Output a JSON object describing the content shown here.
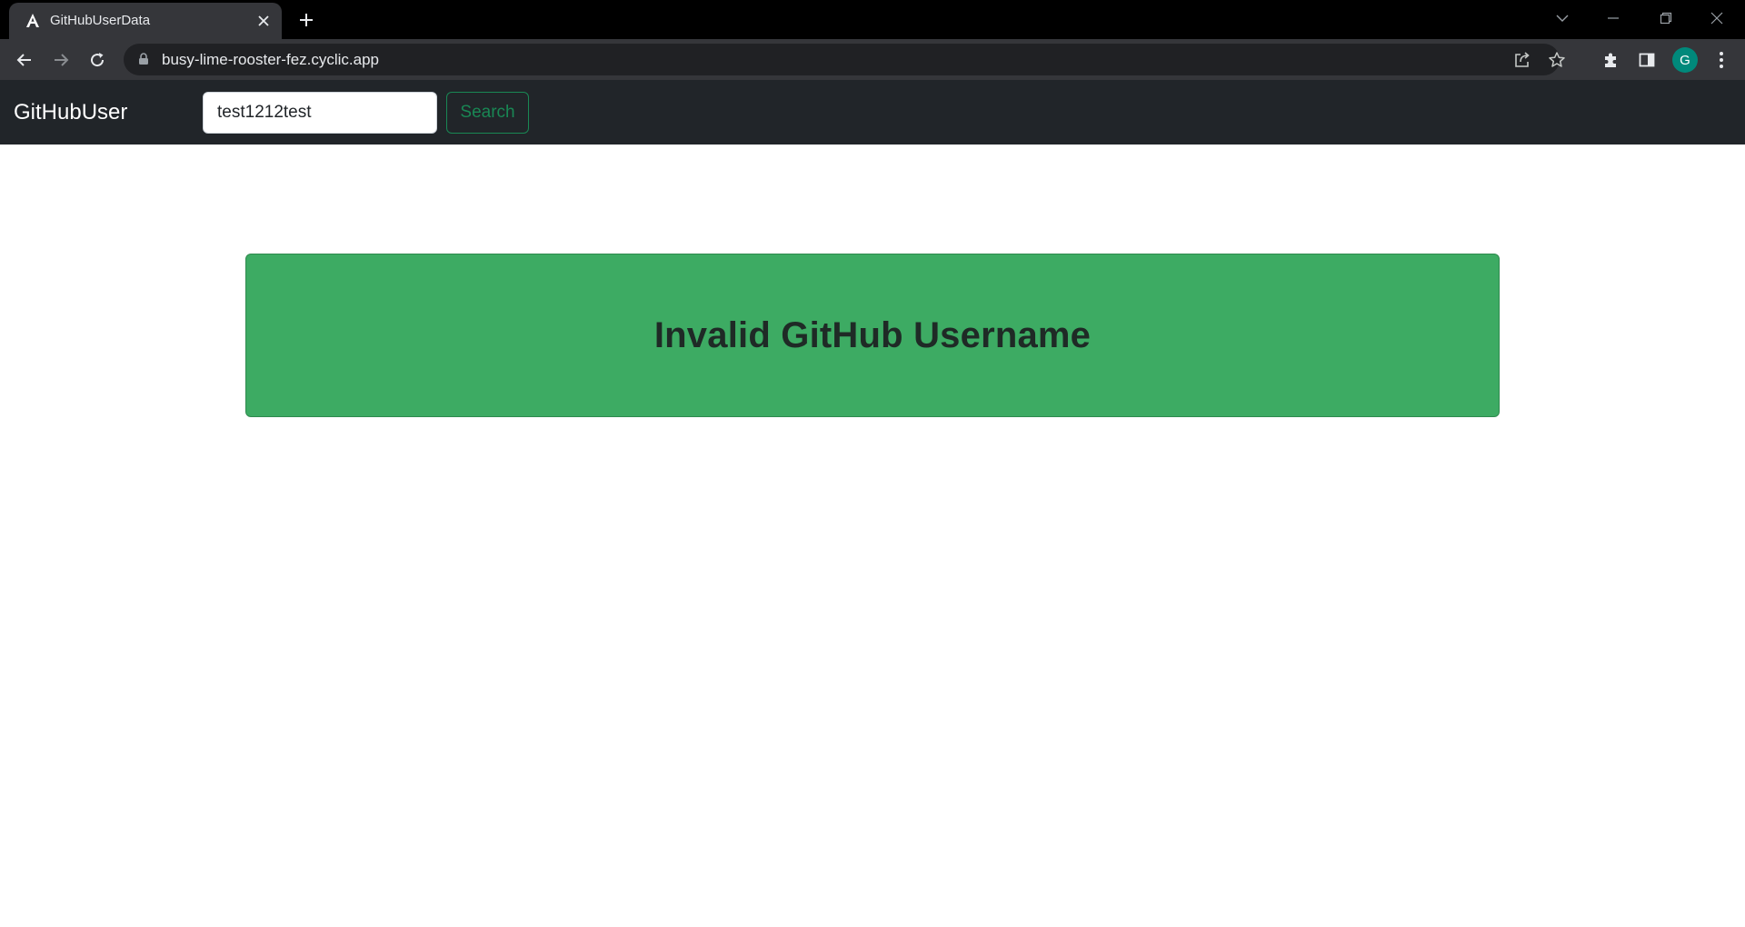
{
  "browser": {
    "tab": {
      "title": "GitHubUserData",
      "favicon": "angular-logo-icon"
    },
    "address_bar": {
      "url": "busy-lime-rooster-fez.cyclic.app"
    },
    "profile_initial": "G",
    "colors": {
      "frame": "#000000",
      "toolbar": "#35363a",
      "omnibox": "#202124",
      "avatar": "#00897b"
    }
  },
  "app": {
    "navbar": {
      "brand": "GitHubUser",
      "search_value": "test1212test",
      "search_button": "Search"
    },
    "alert": {
      "message": "Invalid GitHub Username"
    },
    "colors": {
      "navbar": "#212529",
      "success": "#198754",
      "alert_bg": "#3dab63"
    }
  }
}
